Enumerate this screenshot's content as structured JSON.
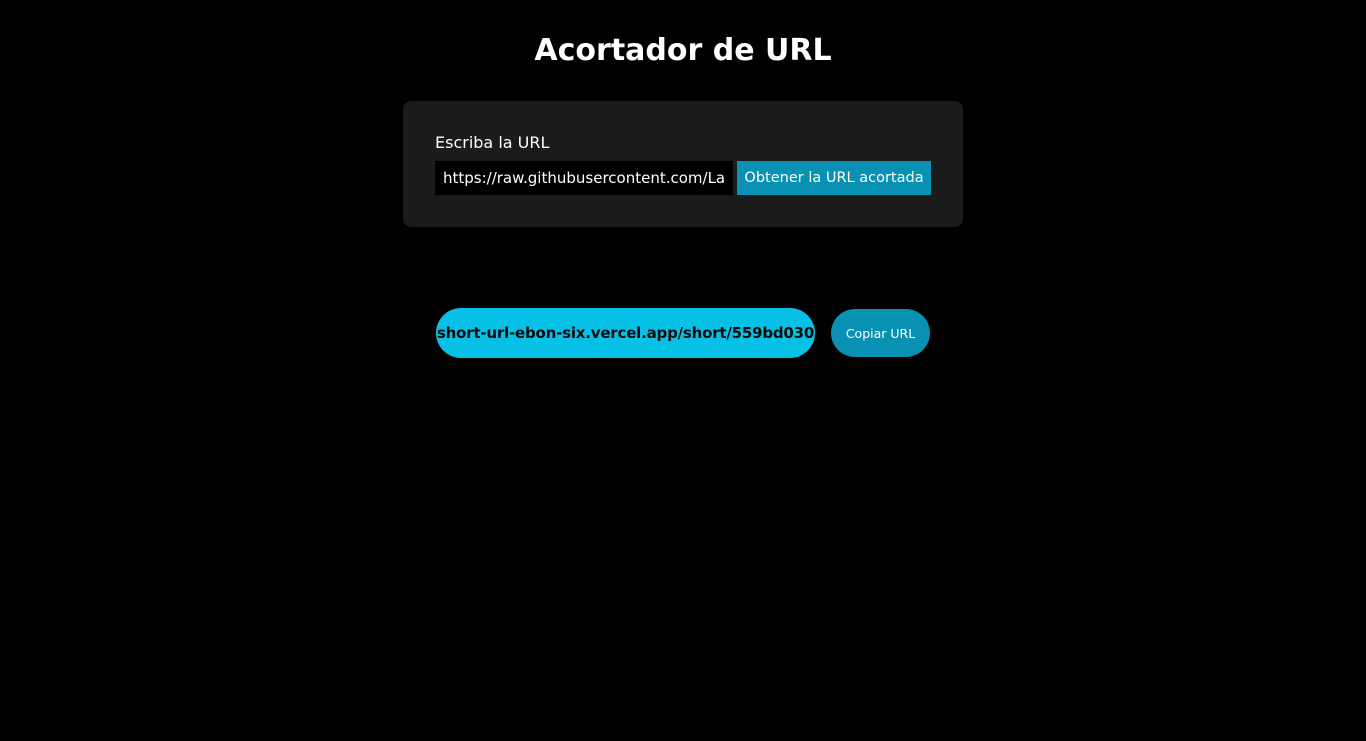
{
  "header": {
    "title": "Acortador de URL"
  },
  "form": {
    "label": "Escriba la URL",
    "url_value": "https://raw.githubusercontent.com/Lau",
    "submit_label": "Obtener la URL acortada"
  },
  "result": {
    "short_url": "short-url-ebon-six.vercel.app/short/559bd030",
    "copy_label": "Copiar URL"
  },
  "colors": {
    "background": "#000000",
    "card": "#1b1b1b",
    "accent": "#0891b2",
    "result_pill": "#06c0e6"
  }
}
